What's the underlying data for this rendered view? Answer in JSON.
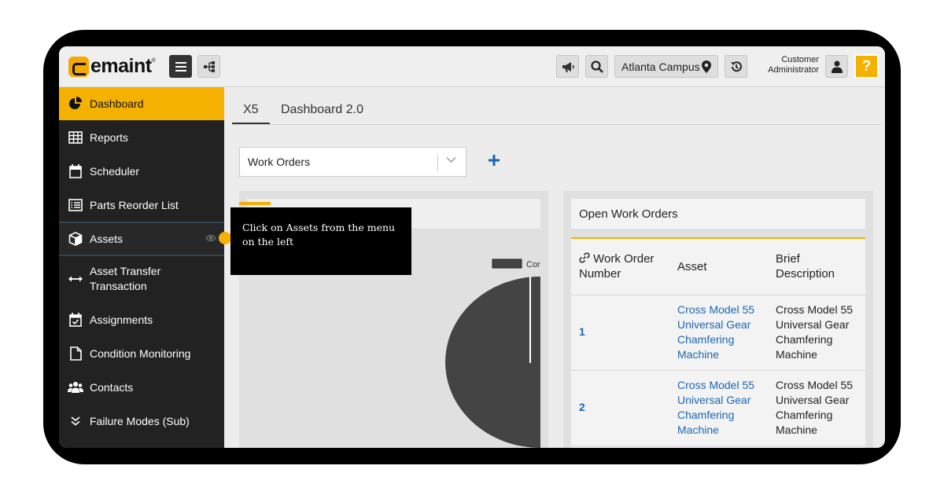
{
  "app": {
    "logo_text": "emaint",
    "logo_tm": "®",
    "campus": "Atlanta Campus",
    "user_name": "Customer Administrator",
    "help_label": "?"
  },
  "sidebar": {
    "items": [
      {
        "label": "Dashboard",
        "icon": "pie-chart-icon",
        "active": true
      },
      {
        "label": "Reports",
        "icon": "table-icon"
      },
      {
        "label": "Scheduler",
        "icon": "calendar-icon"
      },
      {
        "label": "Parts Reorder List",
        "icon": "list-icon"
      },
      {
        "label": "Assets",
        "icon": "cube-icon"
      },
      {
        "label": "Asset Transfer Transaction",
        "icon": "arrows-icon"
      },
      {
        "label": "Assignments",
        "icon": "calendar-check-icon"
      },
      {
        "label": "Condition Monitoring",
        "icon": "document-icon"
      },
      {
        "label": "Contacts",
        "icon": "users-icon"
      },
      {
        "label": "Failure Modes (Sub)",
        "icon": "chevrons-down-icon"
      }
    ],
    "assets_line1": "Asset Transfer",
    "assets_line2": "Transaction"
  },
  "tabs": [
    "X5",
    "Dashboard 2.0"
  ],
  "dropdown": {
    "value": "Work Orders"
  },
  "left_panel": {
    "legend_label": "Cor"
  },
  "open_work_orders": {
    "title": "Open Work Orders",
    "headers": {
      "wo_line1": "Work Order",
      "wo_line2": "Number",
      "asset": "Asset",
      "desc_line1": "Brief",
      "desc_line2": "Description"
    },
    "rows": [
      {
        "number": "1",
        "asset": [
          "Cross Model 55",
          "Universal Gear",
          "Chamfering",
          "Machine"
        ],
        "description": [
          "Cross Model 55",
          "Universal Gear",
          "Chamfering",
          "Machine"
        ]
      },
      {
        "number": "2",
        "asset": [
          "Cross Model 55",
          "Universal Gear",
          "Chamfering",
          "Machine"
        ],
        "description": [
          "Cross Model 55",
          "Universal Gear",
          "Chamfering",
          "Machine"
        ]
      }
    ]
  },
  "tooltip": {
    "text": "Click on Assets from the menu on the left"
  }
}
